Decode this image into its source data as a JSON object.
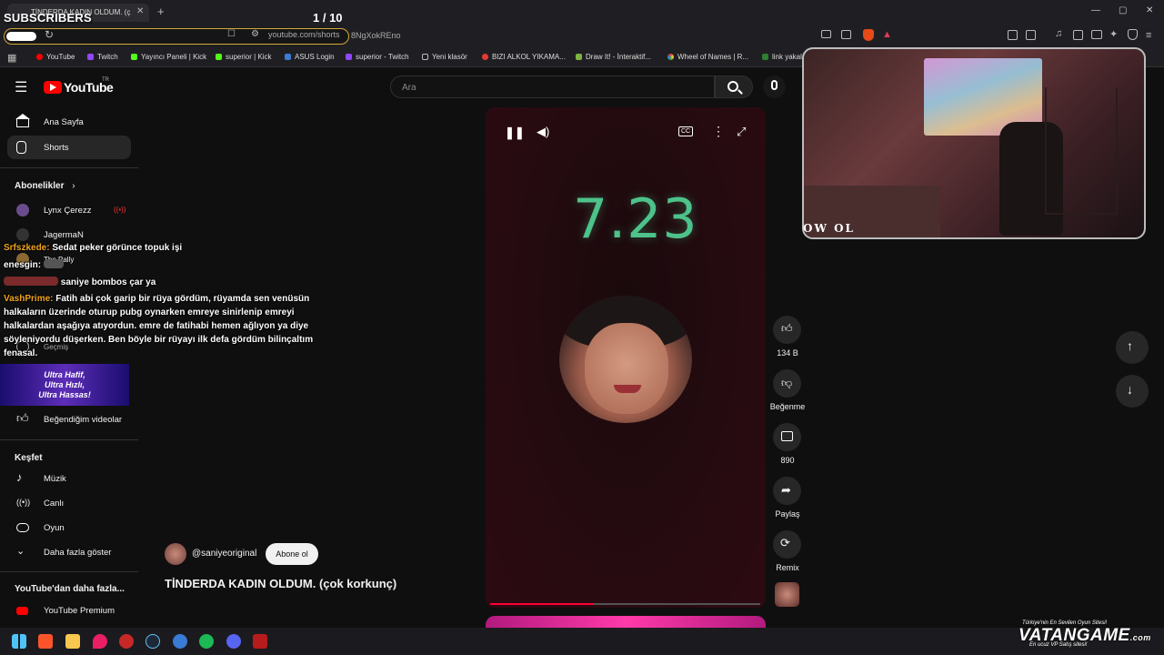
{
  "overlay": {
    "subscribers_label": "SUBSCRIBERS",
    "counter": "1 / 10",
    "webcam_label": "OW OL",
    "banner_lines": [
      "Ultra Hafif,",
      "Ultra Hızlı,",
      "Ultra Hassas!"
    ]
  },
  "browser": {
    "tab_title": "TİNDERDA KADIN OLDUM. (ç",
    "url": "youtube.com/shorts",
    "url_tail": "8NgXokREno",
    "bookmarks": [
      "YouTube",
      "Twitch",
      "Yayıncı Paneli | Kick",
      "superior | Kick",
      "ASUS Login",
      "superior - Twitch",
      "Yeni klasör",
      "BIZI ALKOL YIKAMA...",
      "Draw It! - İnteraktif...",
      "Wheel of Names | R...",
      "link yakala"
    ]
  },
  "youtube": {
    "logo_text": "YouTube",
    "country": "TR",
    "search_placeholder": "Ara",
    "nav": [
      {
        "label": "Ana Sayfa",
        "icon": "home-icon"
      },
      {
        "label": "Shorts",
        "icon": "shorts-icon"
      }
    ],
    "subs_title": "Abonelikler",
    "subs": [
      {
        "label": "Lynx Çerezz",
        "icon": "live-icon"
      },
      {
        "label": "JagermaN"
      },
      {
        "label": "The Pally"
      }
    ],
    "you_items": [
      {
        "label": "Geçmiş"
      },
      {
        "label": "Beğendiğim videolar"
      }
    ],
    "explore_title": "Keşfet",
    "explore": [
      {
        "label": "Müzik",
        "icon": "music-icon"
      },
      {
        "label": "Canlı",
        "icon": "live-broadcast-icon"
      },
      {
        "label": "Oyun",
        "icon": "gamepad-icon"
      },
      {
        "label": "Daha fazla göster",
        "icon": "chevron-down-icon"
      }
    ],
    "more_title": "YouTube'dan daha fazla...",
    "premium": "YouTube Premium"
  },
  "short": {
    "overlay_number": "7.23",
    "channel": "@saniyeoriginal",
    "subscribe_label": "Abone ol",
    "title": "TİNDERDA KADIN OLDUM. (çok korkunç)",
    "progress": 0.38,
    "actions": [
      {
        "label": "134 B",
        "icon": "like-icon"
      },
      {
        "label": "Beğenme",
        "icon": "dislike-icon"
      },
      {
        "label": "890",
        "icon": "comment-icon"
      },
      {
        "label": "Paylaş",
        "icon": "share-icon"
      },
      {
        "label": "Remix",
        "icon": "remix-icon"
      }
    ]
  },
  "chat": [
    {
      "name": "Srfszkede:",
      "text": "Sedat peker görünce topuk işi"
    },
    {
      "name": "enesgin:",
      "text": ""
    },
    {
      "name": "",
      "text": "saniye bombos çar ya"
    },
    {
      "name": "VashPrime:",
      "text": "Fatih abi çok garip bir rüya gördüm, rüyamda sen venüsün halkaların üzerinde oturup pubg oynarken emreye sinirlenip emreyi halkalardan aşağıya atıyordun. emre de fatihabi hemen ağlıyon ya diye söyleniyordu düşerken. Ben böyle bir rüyayı ilk defa gördüm bilinçaltım fenasal."
    }
  ],
  "sponsor": {
    "top": "Türkiye'nin En Sevilen Oyun Sitesi!",
    "name": "VATANGAME",
    "suffix": ".com",
    "sub": "En ucuz VP Satış sitesi!"
  }
}
